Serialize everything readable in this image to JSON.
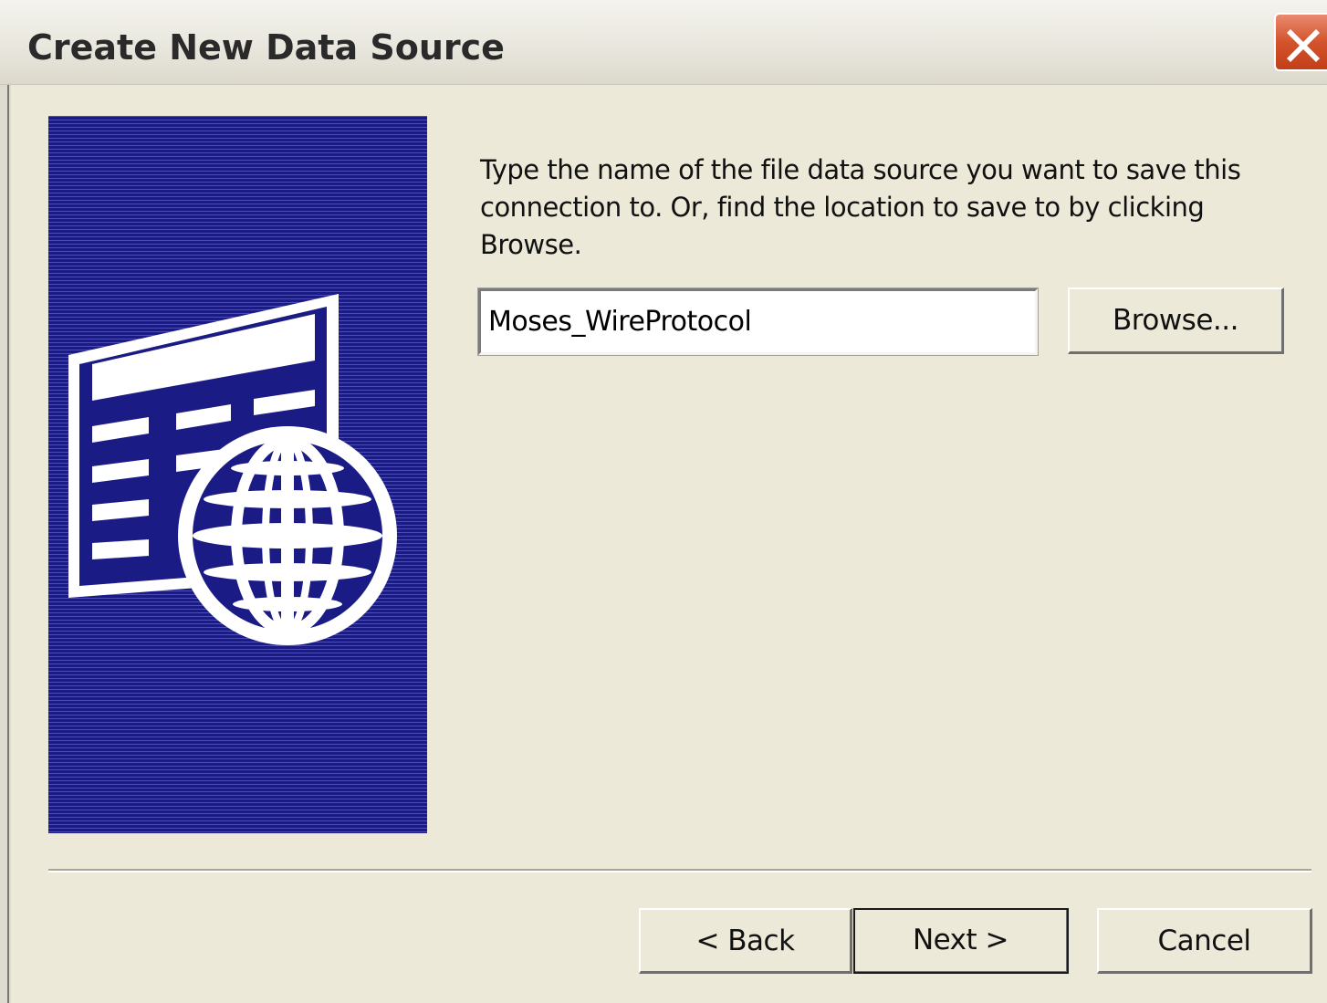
{
  "window": {
    "title": "Create New Data Source"
  },
  "main": {
    "instructions": "Type the name of the file data source you want to save this connection to.  Or, find the location to save to by clicking Browse.",
    "dsn_value": "Moses_WireProtocol",
    "browse_label": "Browse..."
  },
  "footer": {
    "back_label": "< Back",
    "next_label": "Next >",
    "cancel_label": "Cancel"
  },
  "icons": {
    "close": "close-icon",
    "banner": "data-source-globe-illustration"
  },
  "colors": {
    "banner_bg": "#1b1b86",
    "dialog_bg": "#ECE9D8",
    "close_red": "#d3542c"
  }
}
